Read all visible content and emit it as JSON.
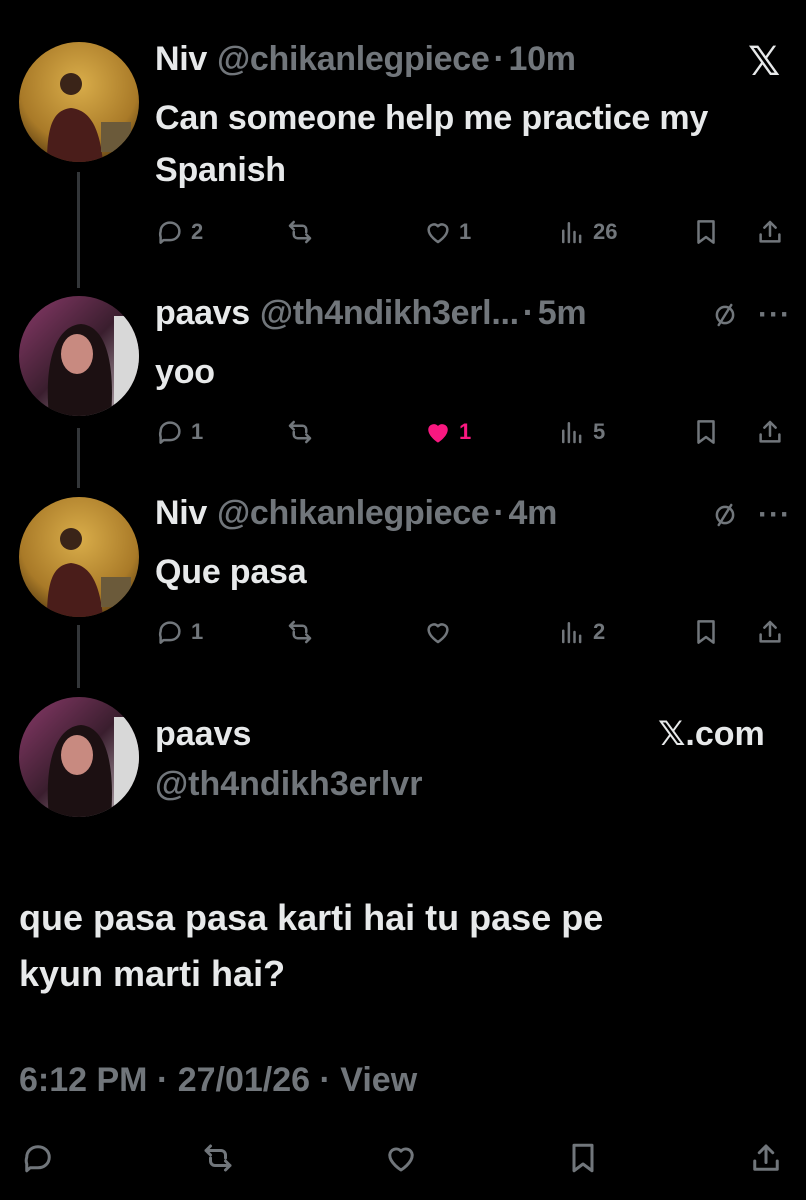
{
  "header": {
    "x_logo": "𝕏"
  },
  "tweets": [
    {
      "name": "Niv",
      "handle": "@chikanlegpiece",
      "time": "10m",
      "text": "Can someone help me practice my Spanish",
      "replies": "2",
      "reposts": "",
      "likes": "1",
      "views": "26",
      "liked": false
    },
    {
      "name": "paavs",
      "handle": "@th4ndikh3erl...",
      "time": "5m",
      "text": "yoo",
      "replies": "1",
      "reposts": "",
      "likes": "1",
      "views": "5",
      "liked": true
    },
    {
      "name": "Niv",
      "handle": "@chikanlegpiece",
      "time": "4m",
      "text": "Que pasa",
      "replies": "1",
      "reposts": "",
      "likes": "",
      "views": "2",
      "liked": false
    }
  ],
  "main_tweet": {
    "name": "paavs",
    "handle": "@th4ndikh3erlvr",
    "source": "𝕏.com",
    "text_line1": "que pasa pasa karti hai tu pase pe",
    "text_line2": "kyun marti hai?",
    "meta": "6:12 PM · 27/01/26 · View"
  },
  "colors": {
    "background": "#000000",
    "text": "#e7e9ea",
    "muted": "#71767b",
    "like_pink": "#f91880"
  },
  "icons": [
    "reply-icon",
    "repost-icon",
    "like-icon",
    "views-icon",
    "bookmark-icon",
    "share-icon",
    "mute-icon",
    "more-icon"
  ]
}
